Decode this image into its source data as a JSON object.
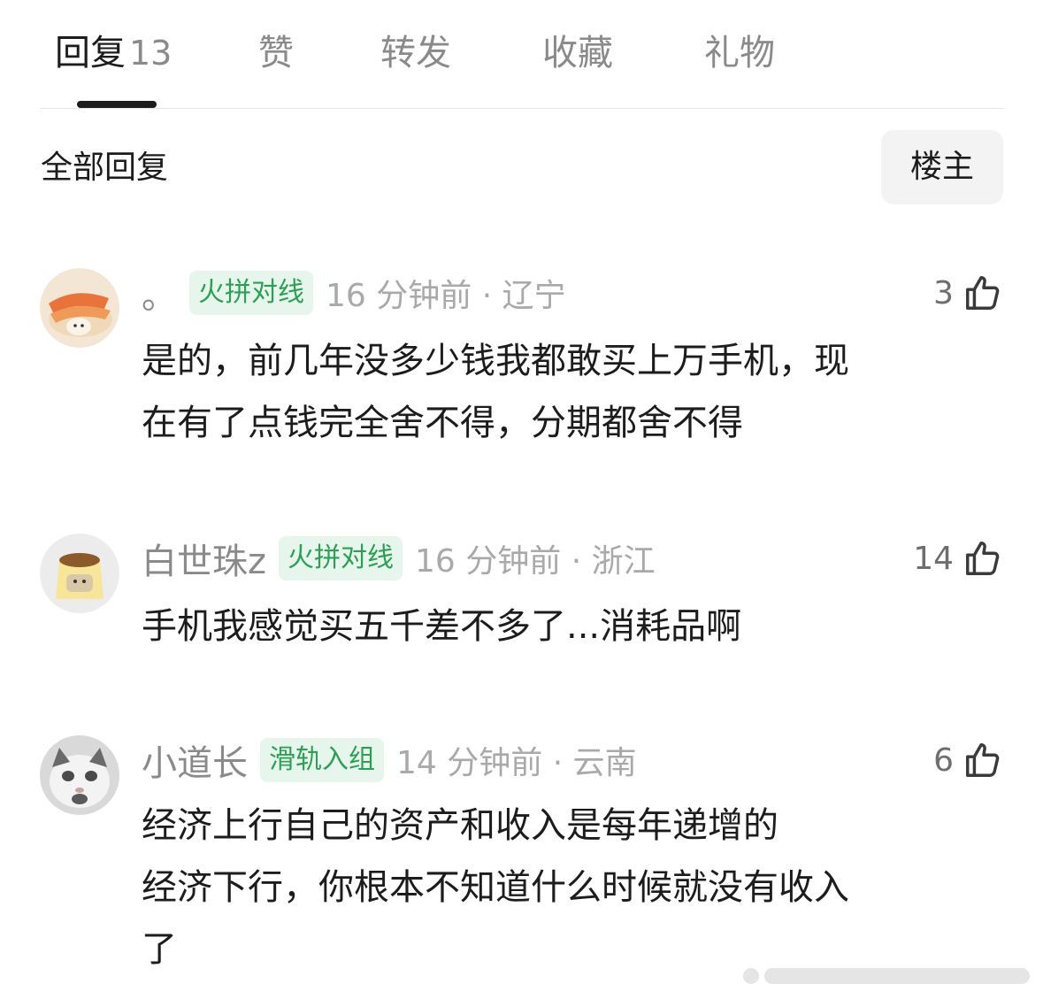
{
  "tabs": [
    {
      "label": "回复",
      "count": "13"
    },
    {
      "label": "赞"
    },
    {
      "label": "转发"
    },
    {
      "label": "收藏"
    },
    {
      "label": "礼物"
    }
  ],
  "section": {
    "title": "全部回复",
    "filter_label": "楼主"
  },
  "comments": [
    {
      "username": "。",
      "badge": "火拼对线",
      "time": "16 分钟前 · 辽宁",
      "likes": "3",
      "lines": [
        "是的，前几年没多少钱我都敢买上万手机，现",
        "在有了点钱完全舍不得，分期都舍不得"
      ]
    },
    {
      "username": "白世珠z",
      "badge": "火拼对线",
      "time": "16 分钟前 · 浙江",
      "likes": "14",
      "lines": [
        "手机我感觉买五千差不多了...消耗品啊"
      ]
    },
    {
      "username": "小道长",
      "badge": "滑轨入组",
      "time": "14 分钟前 · 云南",
      "likes": "6",
      "lines": [
        "经济上行自己的资产和收入是每年递增的",
        "经济下行，你根本不知道什么时候就没有收入",
        "了"
      ]
    }
  ],
  "colors": {
    "badge_bg": "#e7f6ec",
    "badge_text": "#2f9e55",
    "muted": "#8a8a8a",
    "primary_text": "#1c1c1c"
  },
  "icons": [
    "thumb-up-icon"
  ]
}
